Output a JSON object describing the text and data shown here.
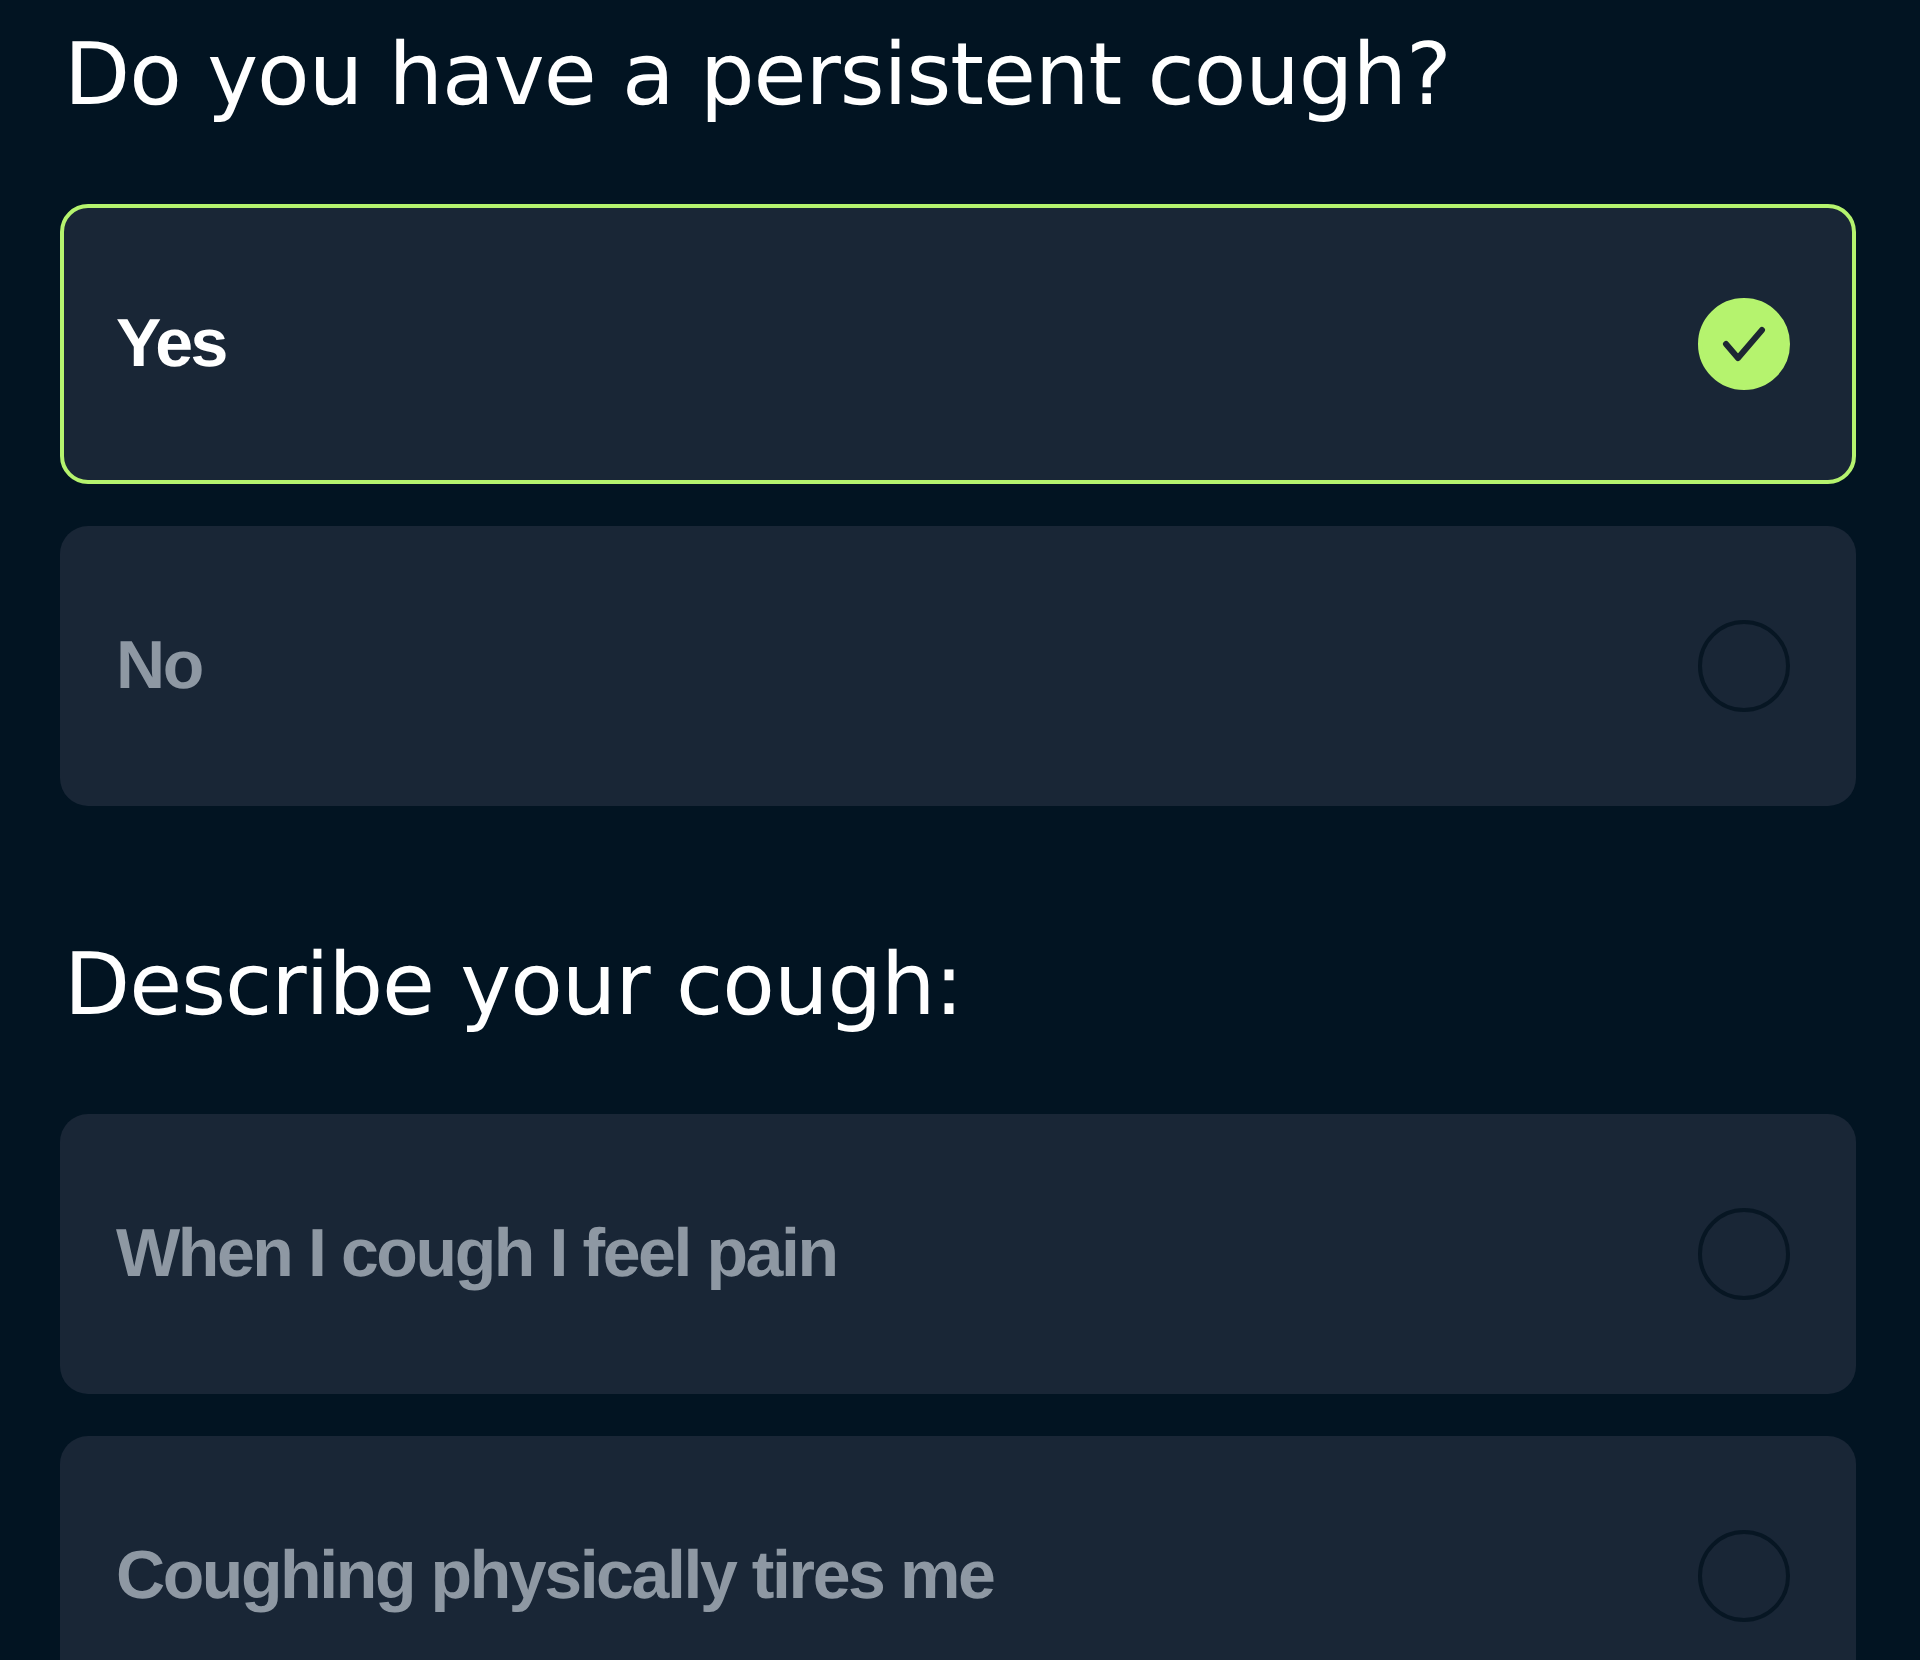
{
  "questions": [
    {
      "title": "Do you have a persistent cough?",
      "options": [
        {
          "label": "Yes",
          "selected": true
        },
        {
          "label": "No",
          "selected": false
        }
      ]
    },
    {
      "title": "Describe your cough:",
      "options": [
        {
          "label": "When I cough I feel pain",
          "selected": false
        },
        {
          "label": "Coughing physically tires me",
          "selected": false
        }
      ]
    }
  ]
}
